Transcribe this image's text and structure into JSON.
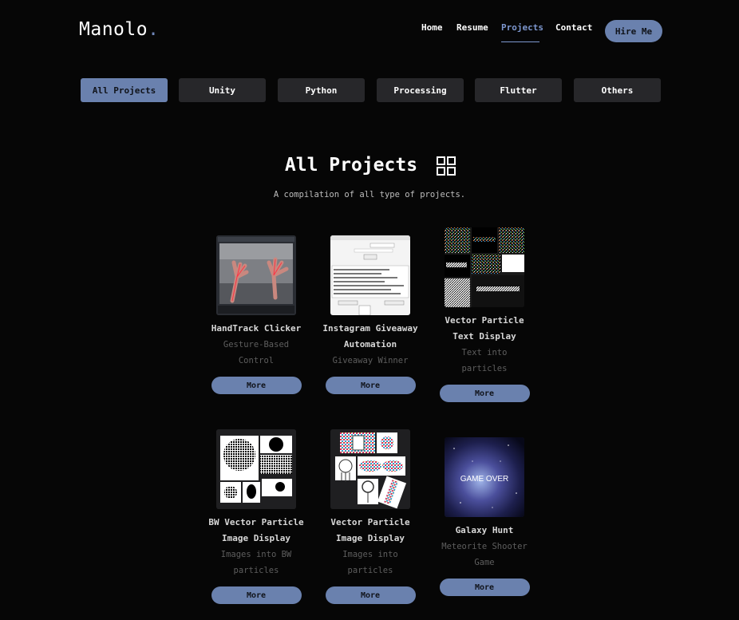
{
  "header": {
    "logo_text": "Manolo",
    "logo_dot": ".",
    "nav": [
      {
        "label": "Home"
      },
      {
        "label": "Resume"
      },
      {
        "label": "Projects",
        "active": true
      },
      {
        "label": "Contact"
      }
    ],
    "hire_label": "Hire Me"
  },
  "filters": [
    {
      "label": "All Projects",
      "active": true
    },
    {
      "label": "Unity"
    },
    {
      "label": "Python"
    },
    {
      "label": "Processing"
    },
    {
      "label": "Flutter"
    },
    {
      "label": "Others"
    }
  ],
  "section": {
    "title": "All Projects",
    "title_icon": "grid-icon",
    "subtitle": "A compilation of all type of projects."
  },
  "projects": [
    {
      "title_1": "HandTrack Clicker",
      "title_2": "",
      "desc_1": "Gesture-Based",
      "desc_2": "Control",
      "more": "More",
      "thumb": "handtrack-image"
    },
    {
      "title_1": "Instagram Giveaway",
      "title_2": "Automation",
      "desc_1": "Giveaway Winner",
      "desc_2": "",
      "more": "More",
      "thumb": "giveaway-app-image"
    },
    {
      "title_1": "Vector Particle",
      "title_2": "Text Display",
      "desc_1": "Text into",
      "desc_2": "particles",
      "more": "More",
      "thumb": "particle-text-image"
    },
    {
      "title_1": "BW Vector Particle",
      "title_2": "Image Display",
      "desc_1": "Images into BW",
      "desc_2": "particles",
      "more": "More",
      "thumb": "bw-particle-image"
    },
    {
      "title_1": "Vector Particle",
      "title_2": "Image Display",
      "desc_1": "Images into",
      "desc_2": "particles",
      "more": "More",
      "thumb": "color-particle-image"
    },
    {
      "title_1": "Galaxy Hunt",
      "title_2": "",
      "desc_1": "Meteorite Shooter",
      "desc_2": "Game",
      "more": "More",
      "thumb": "galaxy-game-image",
      "thumb_text": "GAME OVER"
    }
  ],
  "colors": {
    "background": "#060606",
    "accent": "#6a81ae",
    "active_link": "#7d97cf",
    "button_dark": "#27272a"
  }
}
